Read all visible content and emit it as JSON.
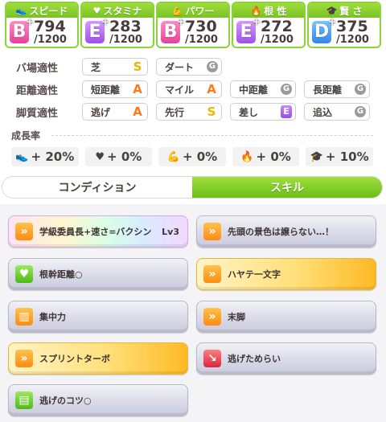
{
  "stats": [
    {
      "name": "スピード",
      "icon": "shoe-icon",
      "grade": "B",
      "plus": true,
      "value": "794",
      "max": "/1200"
    },
    {
      "name": "スタミナ",
      "icon": "heart-icon",
      "grade": "E",
      "plus": true,
      "value": "283",
      "max": "/1200"
    },
    {
      "name": "パワー",
      "icon": "arm-icon",
      "grade": "B",
      "plus": true,
      "value": "730",
      "max": "/1200"
    },
    {
      "name": "根 性",
      "icon": "flame-icon",
      "grade": "E",
      "plus": true,
      "value": "272",
      "max": "/1200"
    },
    {
      "name": "賢 さ",
      "icon": "graduation-cap-icon",
      "grade": "D",
      "plus": true,
      "value": "375",
      "max": "/1200"
    }
  ],
  "aptitude": {
    "track": {
      "label": "バ場適性",
      "items": [
        {
          "name": "芝",
          "rank": "S"
        },
        {
          "name": "ダート",
          "rank": "G"
        }
      ]
    },
    "distance": {
      "label": "距離適性",
      "items": [
        {
          "name": "短距離",
          "rank": "A"
        },
        {
          "name": "マイル",
          "rank": "A"
        },
        {
          "name": "中距離",
          "rank": "G"
        },
        {
          "name": "長距離",
          "rank": "G"
        }
      ]
    },
    "style": {
      "label": "脚質適性",
      "items": [
        {
          "name": "逃げ",
          "rank": "A"
        },
        {
          "name": "先行",
          "rank": "S"
        },
        {
          "name": "差し",
          "rank": "E"
        },
        {
          "name": "追込",
          "rank": "G"
        }
      ]
    }
  },
  "growth": {
    "title": "成長率",
    "items": [
      {
        "icon": "shoe-icon",
        "value": "+ 20%"
      },
      {
        "icon": "heart-icon",
        "value": "+ 0%"
      },
      {
        "icon": "arm-icon",
        "value": "+ 0%"
      },
      {
        "icon": "flame-icon",
        "value": "+ 0%"
      },
      {
        "icon": "graduation-cap-icon",
        "value": "+ 10%"
      }
    ]
  },
  "tabs": {
    "condition": "コンディション",
    "skill": "スキル"
  },
  "skills": [
    {
      "name": "学級委員長+速さ=バクシン",
      "level": "Lv3",
      "tier": "rainbow",
      "icon": "speed-skill-icon"
    },
    {
      "name": "先頭の景色は譲らない…！",
      "level": "",
      "tier": "normal",
      "icon": "speed-skill-icon"
    },
    {
      "name": "根幹距離○",
      "level": "",
      "tier": "normal",
      "icon": "heart-skill-icon"
    },
    {
      "name": "ハヤテ一文字",
      "level": "",
      "tier": "gold",
      "icon": "speed-skill-icon"
    },
    {
      "name": "集中力",
      "level": "",
      "tier": "normal",
      "icon": "gate-skill-icon"
    },
    {
      "name": "末脚",
      "level": "",
      "tier": "normal",
      "icon": "speed-skill-icon"
    },
    {
      "name": "スプリントターボ",
      "level": "",
      "tier": "gold",
      "icon": "speed-skill-icon"
    },
    {
      "name": "逃げためらい",
      "level": "",
      "tier": "normal",
      "icon": "debuff-skill-icon"
    },
    {
      "name": "逃げのコツ○",
      "level": "",
      "tier": "normal",
      "icon": "book-skill-icon"
    }
  ]
}
